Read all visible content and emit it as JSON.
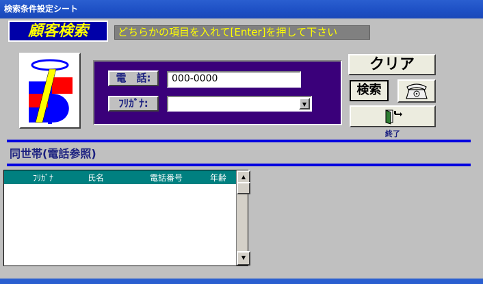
{
  "window": {
    "title": "検索条件設定シート"
  },
  "header": {
    "title": "顧客検索",
    "instruction": "どちらかの項目を入れて[Enter]を押して下さい"
  },
  "form": {
    "phone_label": "電　話:",
    "phone_value": "000-0000",
    "kana_label": "ﾌﾘｶﾞﾅ:",
    "kana_value": ""
  },
  "buttons": {
    "clear": "クリア",
    "search": "検索",
    "telephone_icon": "telephone-icon",
    "exit_icon": "exit-door-icon",
    "exit_label": "終了"
  },
  "household": {
    "title": "同世帯(電話参照)",
    "columns": [
      "ﾌﾘｶﾞﾅ",
      "氏名",
      "電話番号",
      "年齢"
    ],
    "rows": []
  },
  "colors": {
    "accent_blue": "#0000e0",
    "panel_purple": "#3a007a",
    "title_yellow": "#ffff00",
    "list_header_teal": "#008080"
  }
}
